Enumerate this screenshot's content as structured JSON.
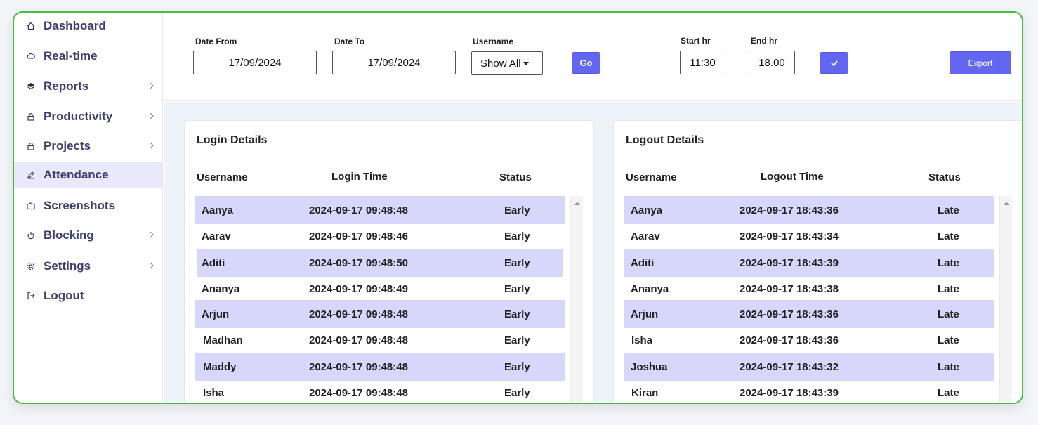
{
  "sidebar": {
    "items": [
      {
        "label": "Dashboard",
        "icon": "home-icon",
        "chevron": false
      },
      {
        "label": "Real-time",
        "icon": "cloud-icon",
        "chevron": false
      },
      {
        "label": "Reports",
        "icon": "layers-icon",
        "chevron": true
      },
      {
        "label": "Productivity",
        "icon": "lock-icon",
        "chevron": true
      },
      {
        "label": "Projects",
        "icon": "lock-icon",
        "chevron": true
      },
      {
        "label": "Attendance",
        "icon": "pen-icon",
        "chevron": false,
        "active": true
      },
      {
        "label": "Screenshots",
        "icon": "camera-icon",
        "chevron": false
      },
      {
        "label": "Blocking",
        "icon": "power-icon",
        "chevron": true
      },
      {
        "label": "Settings",
        "icon": "gear-icon",
        "chevron": true
      },
      {
        "label": "Logout",
        "icon": "logout-icon",
        "chevron": false
      }
    ]
  },
  "filters": {
    "date_from_label": "Date From",
    "date_from_value": "17/09/2024",
    "date_to_label": "Date To",
    "date_to_value": "17/09/2024",
    "username_label": "Username",
    "username_value": "Show All",
    "go_label": "Go",
    "start_hr_label": "Start hr",
    "start_hr_value": "11:30",
    "end_hr_label": "End hr",
    "end_hr_value": "18.00",
    "confirm_icon": "check-icon",
    "export_label": "Export"
  },
  "login": {
    "title": "Login Details",
    "headers": {
      "username": "Username",
      "time": "Login Time",
      "status": "Status"
    },
    "rows": [
      {
        "username": "Aanya",
        "time": "2024-09-17 09:48:48",
        "status": "Early"
      },
      {
        "username": "Aarav",
        "time": "2024-09-17 09:48:46",
        "status": "Early"
      },
      {
        "username": "Aditi",
        "time": "2024-09-17 09:48:50",
        "status": "Early"
      },
      {
        "username": "Ananya",
        "time": "2024-09-17 09:48:49",
        "status": "Early"
      },
      {
        "username": "Arjun",
        "time": "2024-09-17 09:48:48",
        "status": "Early"
      },
      {
        "username": "Madhan",
        "time": "2024-09-17 09:48:48",
        "status": "Early"
      },
      {
        "username": "Maddy",
        "time": "2024-09-17 09:48:48",
        "status": "Early"
      },
      {
        "username": "Isha",
        "time": "2024-09-17 09:48:48",
        "status": "Early"
      }
    ]
  },
  "logout": {
    "title": "Logout Details",
    "headers": {
      "username": "Username",
      "time": "Logout Time",
      "status": "Status"
    },
    "rows": [
      {
        "username": "Aanya",
        "time": "2024-09-17 18:43:36",
        "status": "Late"
      },
      {
        "username": "Aarav",
        "time": "2024-09-17 18:43:34",
        "status": "Late"
      },
      {
        "username": "Aditi",
        "time": "2024-09-17 18:43:39",
        "status": "Late"
      },
      {
        "username": "Ananya",
        "time": "2024-09-17 18:43:38",
        "status": "Late"
      },
      {
        "username": "Arjun",
        "time": "2024-09-17 18:43:36",
        "status": "Late"
      },
      {
        "username": "Isha",
        "time": "2024-09-17 18:43:36",
        "status": "Late"
      },
      {
        "username": "Joshua",
        "time": "2024-09-17 18:43:32",
        "status": "Late"
      },
      {
        "username": "Kiran",
        "time": "2024-09-17 18:43:39",
        "status": "Late"
      }
    ]
  },
  "colors": {
    "accent": "#6366f1",
    "row_highlight": "#d6d7fb",
    "nav_text": "#3e3f73",
    "frame_border": "#3fbf3f"
  }
}
